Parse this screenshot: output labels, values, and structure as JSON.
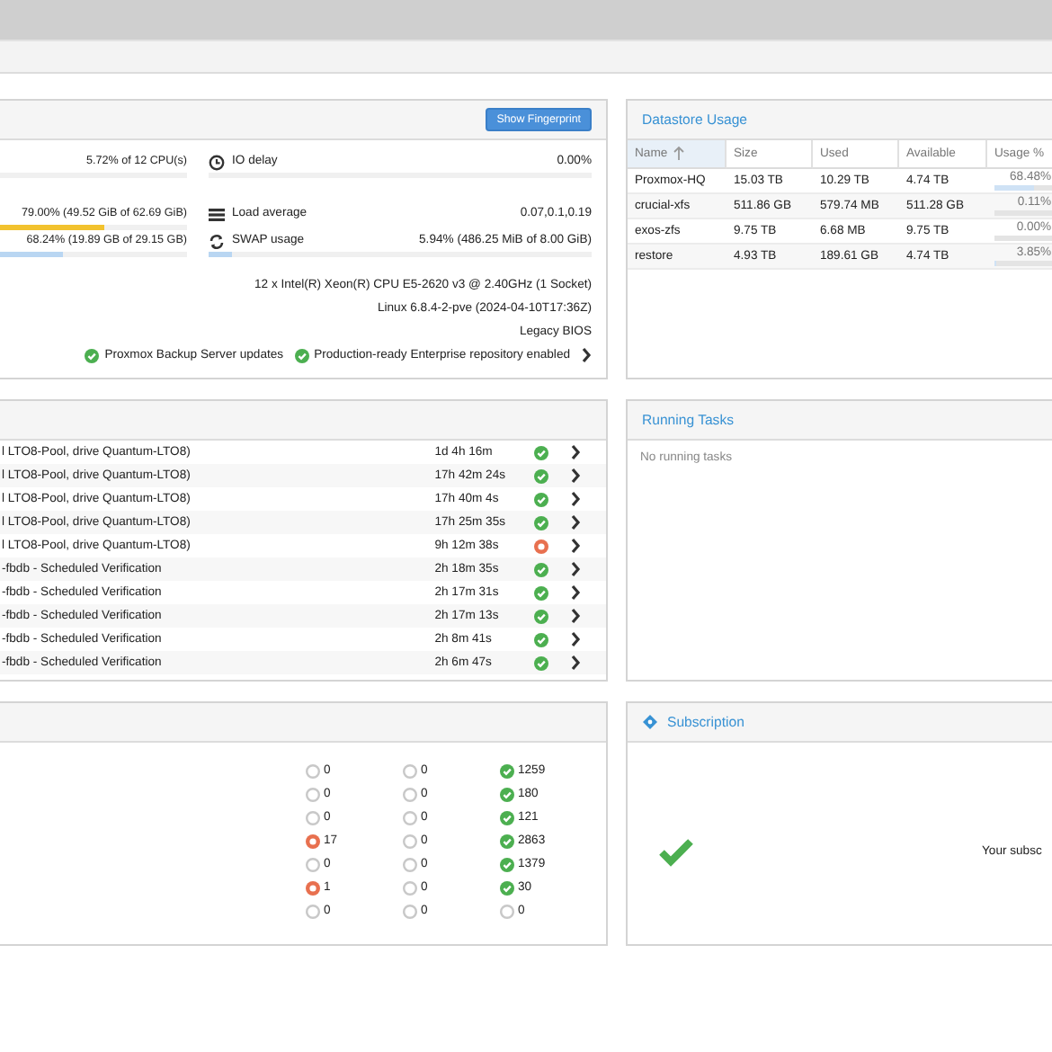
{
  "status_panel": {
    "button": "Show Fingerprint",
    "left": [
      {
        "value": "5.72% of 12 CPU(s)",
        "level": 0
      },
      {
        "value": "79.00% (49.52 GiB of 62.69 GiB)",
        "level": 0.56,
        "warning": true
      },
      {
        "value": "68.24% (19.89 GB of 29.15 GB)",
        "level": 0.34,
        "warning": false
      }
    ],
    "right": [
      {
        "kind": "meter",
        "label": "IO delay",
        "value": "0.00%",
        "level": 0
      },
      {
        "kind": "plain",
        "label": "Load average",
        "value": "0.07,0.1,0.19"
      },
      {
        "kind": "meter",
        "label": "SWAP usage",
        "value": "5.94% (486.25 MiB of 8.00 GiB)",
        "level": 0.06,
        "warning": false
      }
    ],
    "info": [
      "12 x Intel(R) Xeon(R) CPU E5-2620 v3 @ 2.40GHz (1 Socket)",
      "Linux 6.8.4-2-pve (2024-04-10T17:36Z)",
      "Legacy BIOS"
    ],
    "repositories": [
      {
        "text": "Proxmox Backup Server updates",
        "ok": true
      },
      {
        "text": "Production-ready Enterprise repository enabled",
        "ok": true
      }
    ]
  },
  "datastore_usage": {
    "title": "Datastore Usage",
    "columns": [
      {
        "label": "Name",
        "sorted": true
      },
      {
        "label": "Size",
        "sorted": false
      },
      {
        "label": "Used",
        "sorted": false
      },
      {
        "label": "Available",
        "sorted": false
      },
      {
        "label": "Usage %",
        "sorted": false
      }
    ],
    "rows": [
      {
        "name": "Proxmox-HQ",
        "size": "15.03 TB",
        "used": "10.29 TB",
        "available": "4.74 TB",
        "usage": "68.48%",
        "level": 0.6848
      },
      {
        "name": "crucial-xfs",
        "size": "511.86 GB",
        "used": "579.74 MB",
        "available": "511.28 GB",
        "usage": "0.11%",
        "level": 0.0011
      },
      {
        "name": "exos-zfs",
        "size": "9.75 TB",
        "used": "6.68 MB",
        "available": "9.75 TB",
        "usage": "0.00%",
        "level": 0
      },
      {
        "name": "restore",
        "size": "4.93 TB",
        "used": "189.61 GB",
        "available": "4.74 TB",
        "usage": "3.85%",
        "level": 0.0385
      }
    ]
  },
  "tasks": [
    {
      "task": "l LTO8-Pool, drive Quantum-LTO8)",
      "duration": "1d 4h 16m",
      "failed": false
    },
    {
      "task": "l LTO8-Pool, drive Quantum-LTO8)",
      "duration": "17h 42m 24s",
      "failed": false
    },
    {
      "task": "l LTO8-Pool, drive Quantum-LTO8)",
      "duration": "17h 40m 4s",
      "failed": false
    },
    {
      "task": "l LTO8-Pool, drive Quantum-LTO8)",
      "duration": "17h 25m 35s",
      "failed": false
    },
    {
      "task": "l LTO8-Pool, drive Quantum-LTO8)",
      "duration": "9h 12m 38s",
      "failed": true
    },
    {
      "task": "-fbdb - Scheduled Verification",
      "duration": "2h 18m 35s",
      "failed": false
    },
    {
      "task": "-fbdb - Scheduled Verification",
      "duration": "2h 17m 31s",
      "failed": false
    },
    {
      "task": "-fbdb - Scheduled Verification",
      "duration": "2h 17m 13s",
      "failed": false
    },
    {
      "task": "-fbdb - Scheduled Verification",
      "duration": "2h 8m 41s",
      "failed": false
    },
    {
      "task": "-fbdb - Scheduled Verification",
      "duration": "2h 6m 47s",
      "failed": false
    }
  ],
  "running_tasks": {
    "title": "Running Tasks",
    "empty_text": "No running tasks"
  },
  "task_counts": [
    {
      "cells": [
        {
          "kind": "idle",
          "value": "0"
        },
        {
          "kind": "idle",
          "value": "0"
        },
        {
          "kind": "ok",
          "value": "1259"
        }
      ]
    },
    {
      "cells": [
        {
          "kind": "idle",
          "value": "0"
        },
        {
          "kind": "idle",
          "value": "0"
        },
        {
          "kind": "ok",
          "value": "180"
        }
      ]
    },
    {
      "cells": [
        {
          "kind": "idle",
          "value": "0"
        },
        {
          "kind": "idle",
          "value": "0"
        },
        {
          "kind": "ok",
          "value": "121"
        }
      ]
    },
    {
      "cells": [
        {
          "kind": "error",
          "value": "17"
        },
        {
          "kind": "idle",
          "value": "0"
        },
        {
          "kind": "ok",
          "value": "2863"
        }
      ]
    },
    {
      "cells": [
        {
          "kind": "idle",
          "value": "0"
        },
        {
          "kind": "idle",
          "value": "0"
        },
        {
          "kind": "ok",
          "value": "1379"
        }
      ]
    },
    {
      "cells": [
        {
          "kind": "error",
          "value": "1"
        },
        {
          "kind": "idle",
          "value": "0"
        },
        {
          "kind": "ok",
          "value": "30"
        }
      ]
    },
    {
      "cells": [
        {
          "kind": "idle",
          "value": "0"
        },
        {
          "kind": "idle",
          "value": "0"
        },
        {
          "kind": "idle",
          "value": "0"
        }
      ]
    }
  ],
  "subscription": {
    "title": "Subscription",
    "active": true,
    "text": "Your subsc"
  }
}
